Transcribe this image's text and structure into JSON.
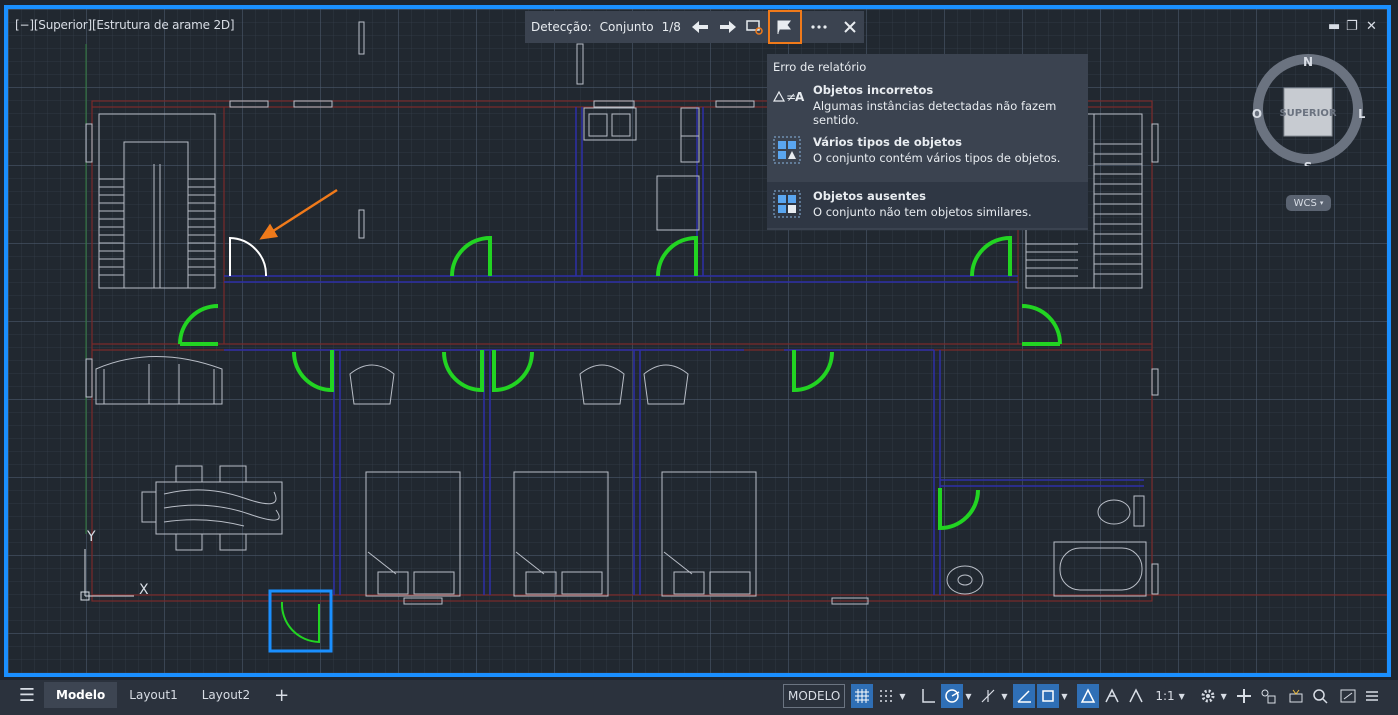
{
  "viewport": {
    "label": "[−][Superior][Estrutura de arame 2D]",
    "win_controls": {
      "minimize": "▬",
      "restore": "❐",
      "close": "✕"
    }
  },
  "detection_toolbar": {
    "label": "Detecção:",
    "set_label": "Conjunto",
    "counter": "1/8",
    "icons": [
      "arrow-left-icon",
      "arrow-right-icon",
      "zoom-to-set-icon",
      "flag-report-icon",
      "more-icon",
      "close-icon"
    ]
  },
  "report_menu": {
    "title": "Erro de relatório",
    "items": [
      {
        "title": "Objetos incorretos",
        "desc": "Algumas instâncias detectadas não fazem sentido.",
        "icon": "not-equal-icon"
      },
      {
        "title": "Vários tipos de objetos",
        "desc": "O conjunto contém vários tipos de objetos.",
        "icon": "mixed-objects-icon"
      },
      {
        "title": "Objetos ausentes",
        "desc": "O conjunto não tem objetos similares.",
        "icon": "missing-objects-icon"
      }
    ]
  },
  "viewcube": {
    "face": "SUPERIOR",
    "north": "N",
    "south": "S",
    "east": "L",
    "west": "O",
    "ucs": "WCS"
  },
  "ucs_icon": {
    "x": "X",
    "y": "Y"
  },
  "layout_tabs": {
    "menu_icon": "☰",
    "tabs": [
      "Modelo",
      "Layout1",
      "Layout2"
    ],
    "add": "+"
  },
  "status_bar": {
    "model_label": "MODELO",
    "scale_label": "1:1",
    "buttons": [
      "grid-icon",
      "snap-icon",
      "ortho-icon",
      "polar-icon",
      "isodraft-icon",
      "osnap-icon",
      "lineweight-icon",
      "transparency-icon",
      "annotation-visibility-icon",
      "autoscale-icon",
      "annotation-scale-icon",
      "workspace-gear-icon",
      "add-icon",
      "isolate-icon",
      "hardware-accel-icon",
      "clean-screen-icon",
      "customize-icon"
    ]
  },
  "colors": {
    "accent_blue": "#1a8fff",
    "highlight_orange": "#f07a1a",
    "detected_green": "#22d422",
    "wall_red": "#8a2b2b",
    "wall_blue": "#2d2fa8",
    "background": "#212830"
  }
}
